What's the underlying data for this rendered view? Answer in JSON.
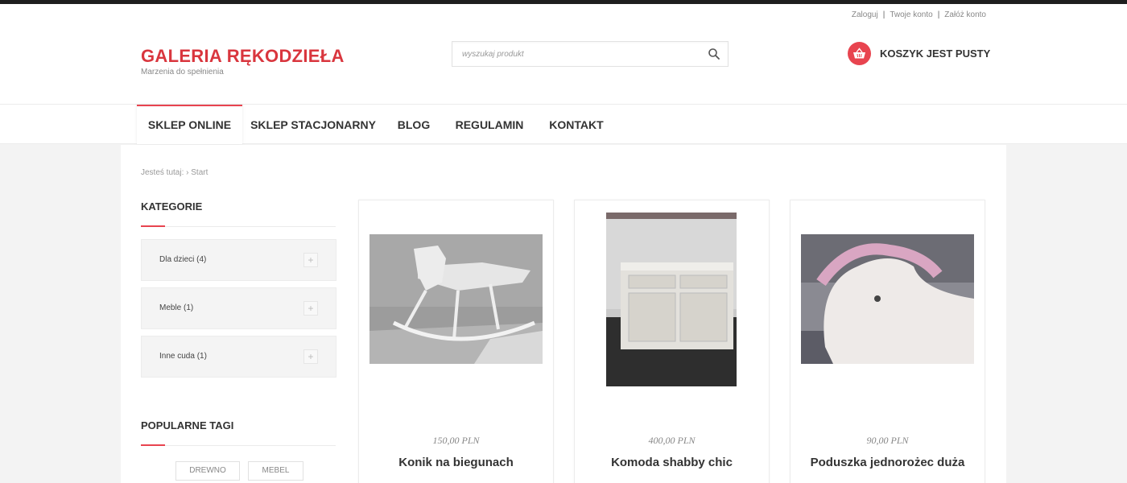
{
  "header": {
    "util_links": [
      {
        "label": "Zaloguj"
      },
      {
        "label": "Twoje konto"
      },
      {
        "label": "Załóż konto"
      }
    ],
    "logo_title": "GALERIA RĘKODZIEŁA",
    "logo_subtitle": "Marzenia do spełnienia",
    "search_placeholder": "wyszukaj produkt",
    "cart_label": "KOSZYK JEST PUSTY"
  },
  "nav": {
    "items": [
      {
        "label": "SKLEP ONLINE",
        "active": true
      },
      {
        "label": "SKLEP STACJONARNY"
      },
      {
        "label": "BLOG"
      },
      {
        "label": "REGULAMIN"
      },
      {
        "label": "KONTAKT"
      }
    ]
  },
  "breadcrumb": {
    "prefix": "Jesteś tutaj:",
    "current": "Start"
  },
  "sidebar": {
    "categories_heading": "KATEGORIE",
    "categories": [
      {
        "label": "Dla dzieci (4)",
        "toggle": "+"
      },
      {
        "label": "Meble (1)",
        "toggle": "+"
      },
      {
        "label": "Inne cuda (1)",
        "toggle": "+"
      }
    ],
    "tags_heading": "POPULARNE TAGI",
    "tags": [
      {
        "label": "DREWNO"
      },
      {
        "label": "MEBEL"
      }
    ]
  },
  "products": [
    {
      "price": "150,00 PLN",
      "name": "Konik na biegunach"
    },
    {
      "price": "400,00 PLN",
      "name": "Komoda shabby chic"
    },
    {
      "price": "90,00 PLN",
      "name": "Poduszka jednorożec duża"
    }
  ],
  "colors": {
    "accent": "#e8444f",
    "logo": "#d9363e",
    "topbar": "#1e1e1e"
  }
}
